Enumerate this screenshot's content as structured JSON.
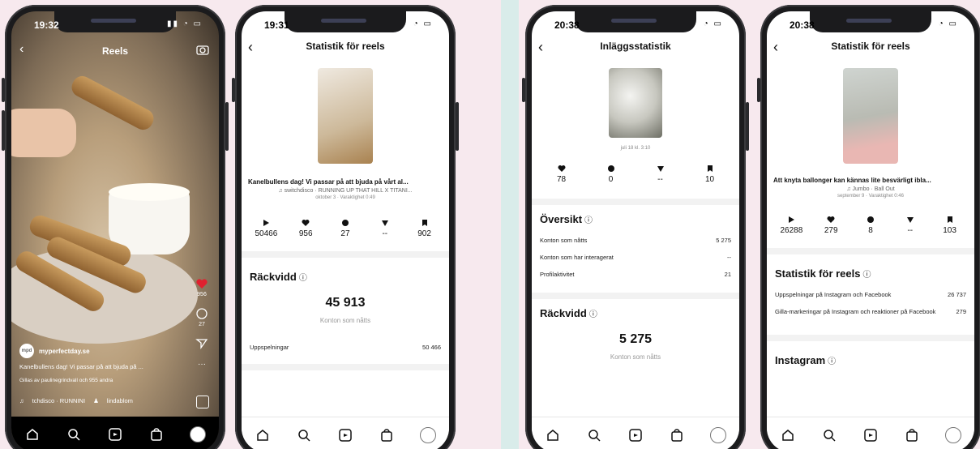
{
  "phone1": {
    "time": "19:32",
    "title": "Reels",
    "likes": "956",
    "comments": "27",
    "username": "myperfectday.se",
    "caption": "Kanelbullens dag! Vi passar på att bjuda på ...",
    "liked_by": "Gillas av paulinegrindvall och 955 andra",
    "audio": "tchdisco · RUNNINI",
    "tagged": "lindablom",
    "avatar_text": "mpd"
  },
  "phone2": {
    "time": "19:31",
    "title": "Statistik för reels",
    "caption": "Kanelbullens dag! Vi passar på att bjuda på vårt al...",
    "audio": "switchdisco · RUNNING UP THAT HILL X TITANI...",
    "meta": "oktober 3 · Varaktighet 0:49",
    "stats": [
      "50466",
      "956",
      "27",
      "--",
      "902"
    ],
    "section_title": "Räckvidd",
    "big_number": "45 913",
    "big_label": "Konton som nåtts",
    "row_label": "Uppspelningar",
    "row_value": "50 466"
  },
  "phone3": {
    "time": "20:38",
    "title": "Inläggsstatistik",
    "meta": "juli 18 kl. 3:10",
    "stats": [
      "78",
      "0",
      "--",
      "10"
    ],
    "overview_title": "Översikt",
    "rows": [
      {
        "label": "Konton som nåtts",
        "value": "5 275"
      },
      {
        "label": "Konton som har interagerat",
        "value": "--"
      },
      {
        "label": "Profilaktivitet",
        "value": "21"
      }
    ],
    "reach_title": "Räckvidd",
    "big_number": "5 275",
    "big_label": "Konton som nåtts"
  },
  "phone4": {
    "time": "20:38",
    "title": "Statistik för reels",
    "caption": "Att knyta ballonger kan kännas lite besvärligt ibla...",
    "audio": "Jumbo · Ball Out",
    "meta": "september 9 · Varaktighet 0:46",
    "stats": [
      "26288",
      "279",
      "8",
      "--",
      "103"
    ],
    "section_title": "Statistik för reels",
    "rows": [
      {
        "label": "Uppspelningar på Instagram och Facebook",
        "value": "26 737"
      },
      {
        "label": "Gilla-markeringar på Instagram och reaktioner på Facebook",
        "value": "279"
      }
    ],
    "instagram_title": "Instagram"
  },
  "colors": {
    "heart": "#e0202f",
    "background": "#d9ecea",
    "band": "#f7e9ee"
  }
}
